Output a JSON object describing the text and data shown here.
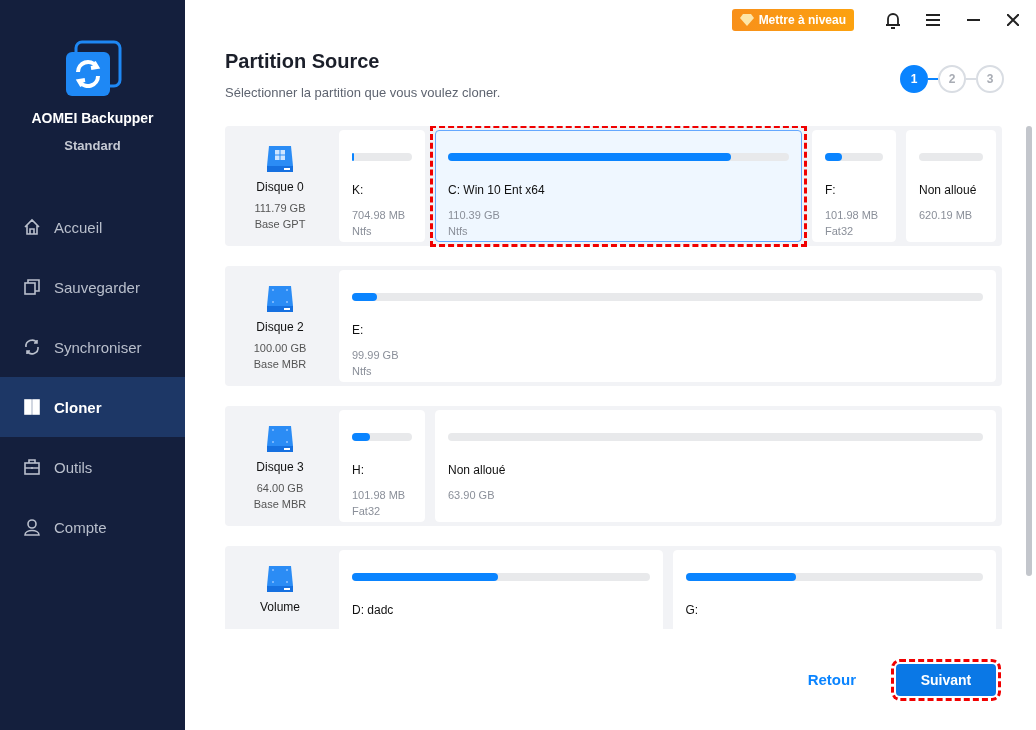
{
  "app": {
    "name": "AOMEI Backupper",
    "edition": "Standard"
  },
  "nav": [
    {
      "label": "Accueil",
      "selected": false
    },
    {
      "label": "Sauvegarder",
      "selected": false
    },
    {
      "label": "Synchroniser",
      "selected": false
    },
    {
      "label": "Cloner",
      "selected": true
    },
    {
      "label": "Outils",
      "selected": false
    },
    {
      "label": "Compte",
      "selected": false
    }
  ],
  "upgrade_button": "Mettre à niveau",
  "title": "Partition Source",
  "subtitle": "Sélectionner la partition que vous voulez cloner.",
  "steps": [
    {
      "label": "1",
      "selected": true
    },
    {
      "label": "2",
      "selected": false
    },
    {
      "label": "3",
      "selected": false
    }
  ],
  "disks": [
    {
      "name": "Disque 0",
      "size": "111.79 GB",
      "type": "Base GPT",
      "system": true,
      "partitions": [
        {
          "kind": "partition",
          "label": "K:",
          "capacity": "704.98 MB",
          "fs": "Ntfs",
          "level": 0.03,
          "selected": false,
          "highlighted": false
        },
        {
          "kind": "partition",
          "label": "C: Win 10 Ent x64",
          "capacity": "110.39 GB",
          "fs": "Ntfs",
          "level": 0.83,
          "selected": true,
          "highlighted": true
        },
        {
          "kind": "partition",
          "label": "F:",
          "capacity": "101.98 MB",
          "fs": "Fat32",
          "level": 0.3,
          "selected": false,
          "highlighted": false
        },
        {
          "kind": "unallocated",
          "label": "Non alloué",
          "capacity": "620.19 MB",
          "selected": false,
          "highlighted": false
        }
      ]
    },
    {
      "name": "Disque 2",
      "size": "100.00 GB",
      "type": "Base MBR",
      "system": false,
      "partitions": [
        {
          "kind": "partition",
          "label": "E:",
          "capacity": "99.99 GB",
          "fs": "Ntfs",
          "level": 0.01,
          "selected": false,
          "highlighted": false
        }
      ]
    },
    {
      "name": "Disque 3",
      "size": "64.00 GB",
      "type": "Base MBR",
      "system": false,
      "partitions": [
        {
          "kind": "partition",
          "label": "H:",
          "capacity": "101.98 MB",
          "fs": "Fat32",
          "level": 0.3,
          "selected": false,
          "highlighted": false
        },
        {
          "kind": "unallocated",
          "label": "Non alloué",
          "capacity": "63.90 GB",
          "selected": false,
          "highlighted": false
        }
      ]
    },
    {
      "name": "Volume",
      "system": false,
      "partitions": [
        {
          "kind": "partition",
          "label": "D: dadc",
          "level": 0.49,
          "selected": false,
          "highlighted": false
        },
        {
          "kind": "partition",
          "label": "G:",
          "level": 0.37,
          "selected": false,
          "highlighted": false
        }
      ]
    }
  ],
  "back_button": "Retour",
  "next_button": {
    "label": "Suivant",
    "highlighted": true
  }
}
